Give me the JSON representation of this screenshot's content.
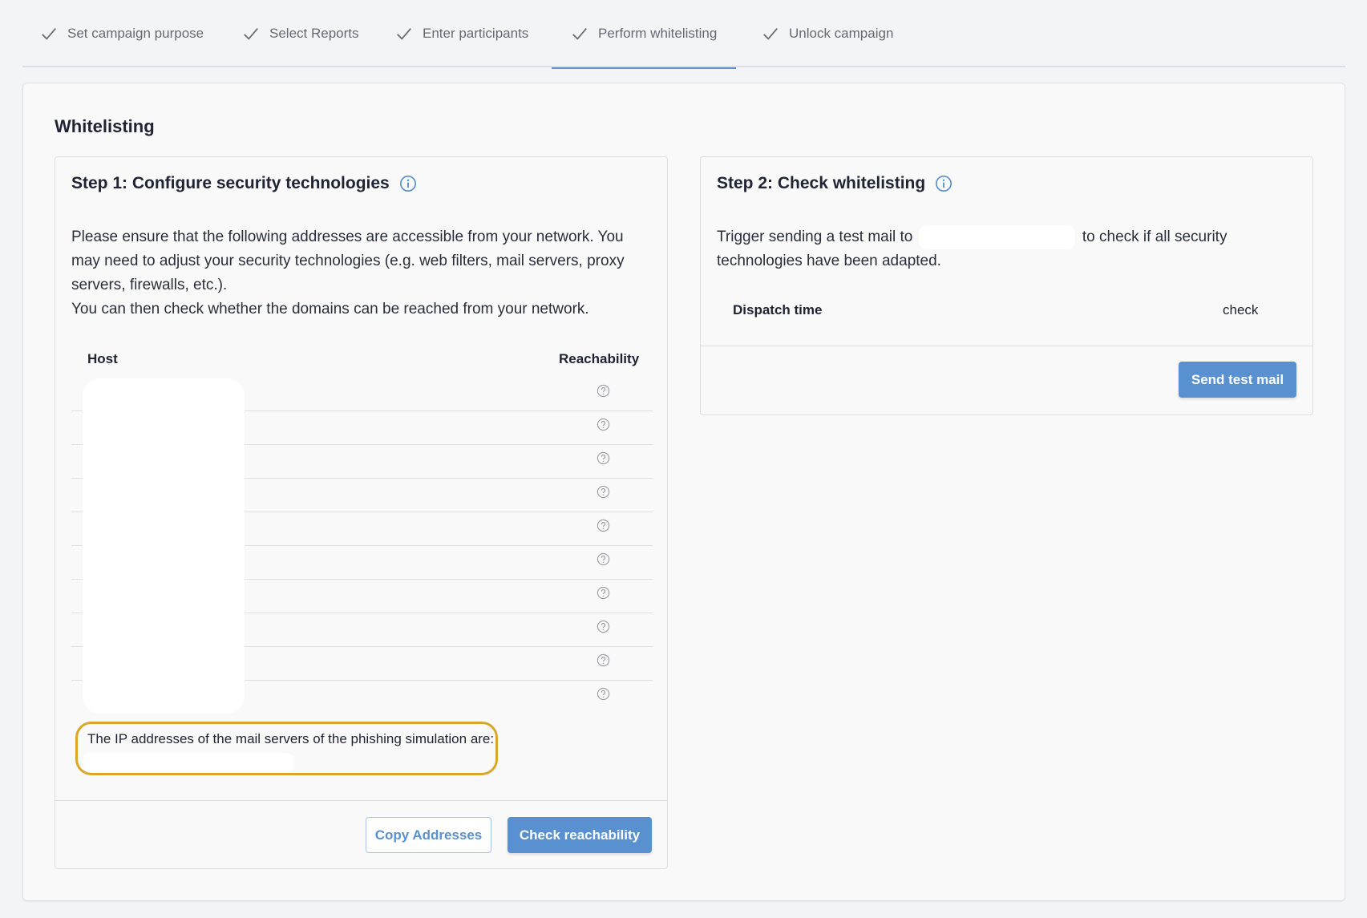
{
  "tabs": [
    {
      "label": "Set campaign purpose",
      "icon": "check-icon",
      "completed": true,
      "active": false
    },
    {
      "label": "Select Reports",
      "icon": "check-icon",
      "completed": true,
      "active": false
    },
    {
      "label": "Enter participants",
      "icon": "check-icon",
      "completed": true,
      "active": false
    },
    {
      "label": "Perform whitelisting",
      "icon": "check-icon",
      "completed": true,
      "active": true
    },
    {
      "label": "Unlock campaign",
      "icon": "check-icon",
      "completed": true,
      "active": false
    }
  ],
  "section_title": "Whitelisting",
  "step1": {
    "title": "Step 1: Configure security technologies",
    "info_icon": "info-icon",
    "description_line1": "Please ensure that the following addresses are accessible from your network. You may need to adjust your security technologies (e.g. web filters, mail servers, proxy servers, firewalls, etc.).",
    "description_line2": "You can then check whether the domains can be reached from your network.",
    "table": {
      "columns": [
        "Host",
        "Reachability"
      ],
      "rows": [
        {
          "host": "",
          "reachability": "unknown",
          "icon": "question-circle-icon"
        },
        {
          "host": "",
          "reachability": "unknown",
          "icon": "question-circle-icon"
        },
        {
          "host": "",
          "reachability": "unknown",
          "icon": "question-circle-icon"
        },
        {
          "host": "",
          "reachability": "unknown",
          "icon": "question-circle-icon"
        },
        {
          "host": "",
          "reachability": "unknown",
          "icon": "question-circle-icon"
        },
        {
          "host": "",
          "reachability": "unknown",
          "icon": "question-circle-icon"
        },
        {
          "host": "",
          "reachability": "unknown",
          "icon": "question-circle-icon"
        },
        {
          "host": "",
          "reachability": "unknown",
          "icon": "question-circle-icon"
        },
        {
          "host": "",
          "reachability": "unknown",
          "icon": "question-circle-icon"
        },
        {
          "host": "",
          "reachability": "unknown",
          "icon": "question-circle-icon"
        }
      ]
    },
    "ip_note": "The IP addresses of the mail servers of the phishing simulation are:",
    "ip_value": "",
    "buttons": {
      "copy": "Copy Addresses",
      "check": "Check reachability"
    }
  },
  "step2": {
    "title": "Step 2: Check whitelisting",
    "info_icon": "info-icon",
    "text_before": "Trigger sending a test mail to",
    "recipient": "",
    "text_after": "to check if all security technologies have been adapted.",
    "table": {
      "columns": [
        "Dispatch time",
        "check"
      ],
      "rows": []
    },
    "buttons": {
      "send": "Send test mail"
    }
  },
  "colors": {
    "accent": "#5890d0",
    "highlight_border": "#d9a628",
    "background": "#f3f4f6",
    "card": "#f9f9f9"
  }
}
